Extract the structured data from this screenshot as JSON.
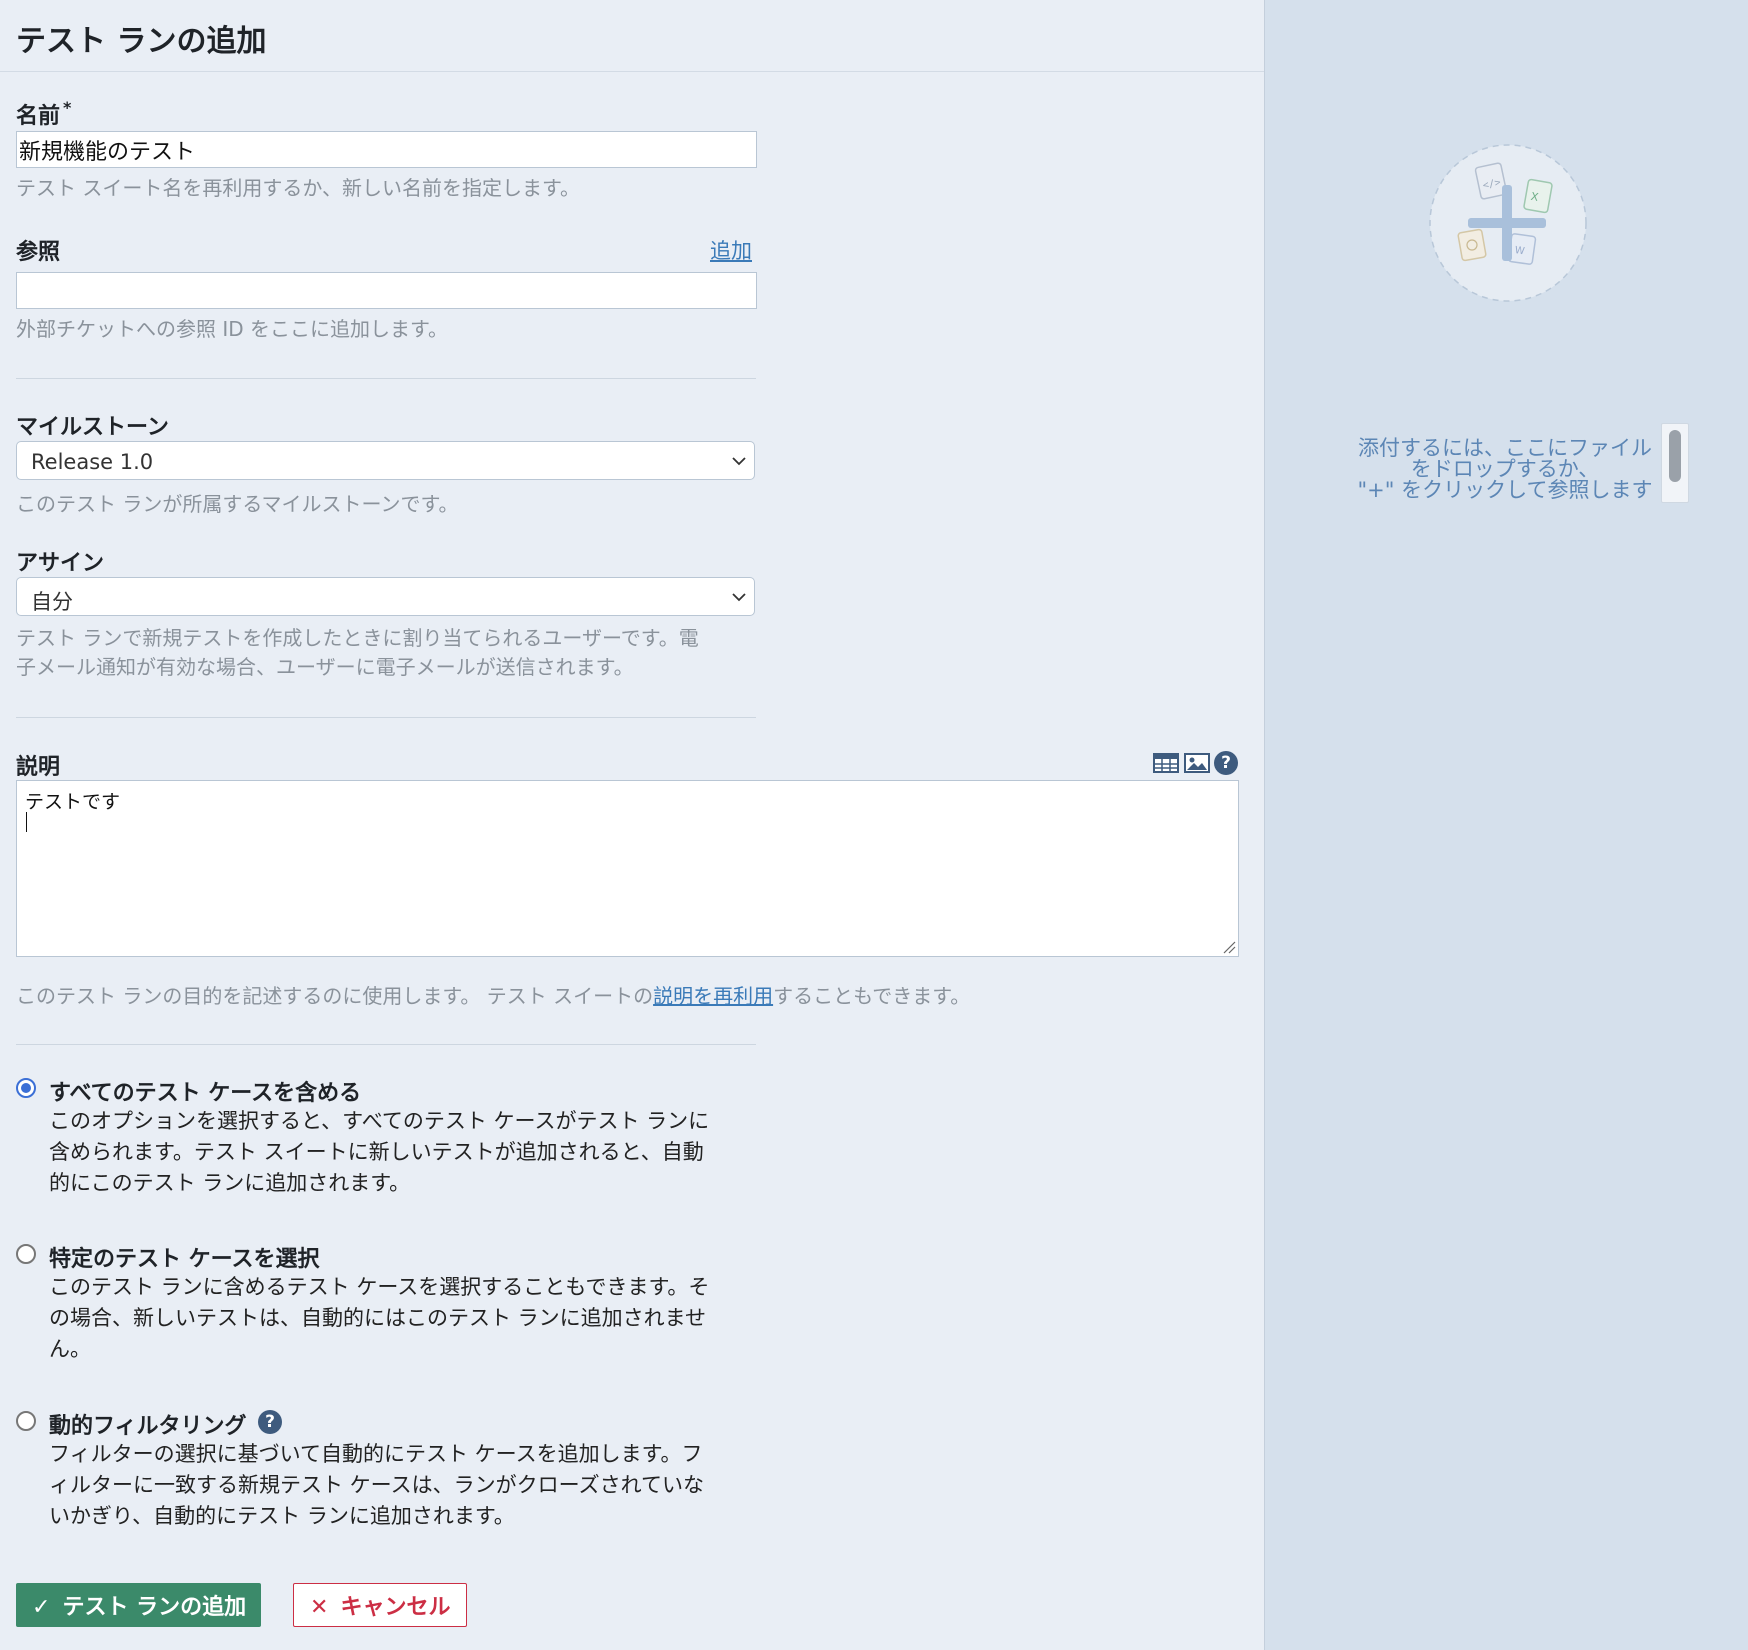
{
  "page": {
    "title": "テスト ランの追加"
  },
  "name_field": {
    "label": "名前",
    "required_mark": "*",
    "value": "新規機能のテスト",
    "hint": "テスト スイート名を再利用するか、新しい名前を指定します。"
  },
  "references_field": {
    "label": "参照",
    "add_link": "追加",
    "value": "",
    "hint": "外部チケットへの参照 ID をここに追加します。"
  },
  "milestone_field": {
    "label": "マイルストーン",
    "selected": "Release 1.0",
    "hint": "このテスト ランが所属するマイルストーンです。"
  },
  "assign_field": {
    "label": "アサイン",
    "selected": "自分",
    "hint_line1": "テスト ランで新規テストを作成したときに割り当てられるユーザーです。電",
    "hint_line2": "子メール通知が有効な場合、ユーザーに電子メールが送信されます。"
  },
  "description_field": {
    "label": "説明",
    "value": "テストです",
    "hint_prefix": "このテスト ランの目的を記述するのに使用します。 テスト スイートの",
    "hint_link": "説明を再利用",
    "hint_suffix": "することもできます。",
    "toolbar_icons": [
      "table-icon",
      "image-icon",
      "help-icon"
    ],
    "help_glyph": "?"
  },
  "case_options": [
    {
      "title": "すべてのテスト ケースを含める",
      "checked": true,
      "lines": [
        "このオプションを選択すると、すべてのテスト ケースがテスト ランに",
        "含められます。テスト スイートに新しいテストが追加されると、自動",
        "的にこのテスト ランに追加されます。"
      ]
    },
    {
      "title": "特定のテスト ケースを選択",
      "checked": false,
      "lines": [
        "このテスト ランに含めるテスト ケースを選択することもできます。そ",
        "の場合、新しいテストは、自動的にはこのテスト ランに追加されませ",
        "ん。"
      ]
    },
    {
      "title": "動的フィルタリング",
      "checked": false,
      "help_glyph": "?",
      "lines": [
        "フィルターの選択に基づいて自動的にテスト ケースを追加します。フ",
        "ィルターに一致する新規テスト ケースは、ランがクローズされていな",
        "いかぎり、自動的にテスト ランに追加されます。"
      ]
    }
  ],
  "buttons": {
    "submit_label": "テスト ランの追加",
    "submit_glyph": "✓",
    "cancel_label": "キャンセル",
    "cancel_glyph": "✕"
  },
  "attachments": {
    "drop_line1": "添付するには、ここにファイル",
    "drop_line2": "をドロップするか、",
    "drop_line3": "\"+\" をクリックして参照します",
    "add_icon": "plus-icon"
  },
  "colors": {
    "background": "#e9eef5",
    "side_panel": "#d5e0ec",
    "submit": "#3b8a6a",
    "cancel": "#cc2e44",
    "link": "#3a7ab8",
    "radio_checked": "#3b6fd6"
  }
}
